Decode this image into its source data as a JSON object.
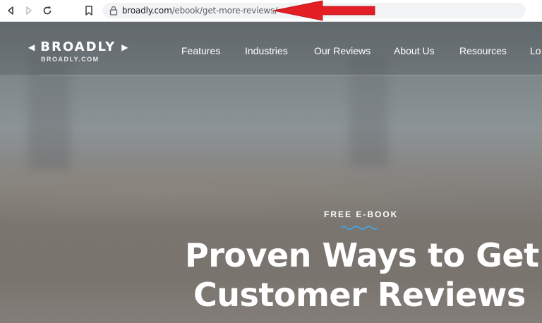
{
  "browser": {
    "url_host": "broadly.com",
    "url_path": "/ebook/get-more-reviews/",
    "icons": [
      "back-icon",
      "forward-icon",
      "reload-icon",
      "bookmark-icon",
      "lock-icon"
    ],
    "annotation_color": "#e31e24"
  },
  "site": {
    "logo": "BROADLY",
    "logo_sub": "BROADLY.COM",
    "nav": [
      "Features",
      "Industries",
      "Our Reviews",
      "About Us",
      "Resources",
      "Lo"
    ]
  },
  "hero": {
    "eyebrow": "FREE E-BOOK",
    "headline_line1": "Proven Ways to Get",
    "headline_line2": "Customer Reviews",
    "accent_color": "#4aa3df"
  }
}
